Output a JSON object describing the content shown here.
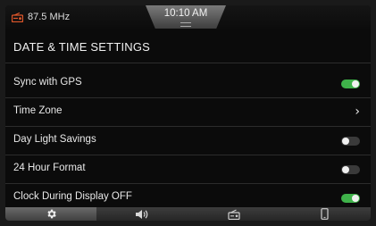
{
  "status_bar": {
    "radio_icon": "radio-icon",
    "frequency": "87.5 MHz",
    "time": "10:10 AM"
  },
  "page": {
    "title": "DATE & TIME SETTINGS"
  },
  "settings": [
    {
      "label": "Sync with GPS",
      "control": "toggle",
      "state": "on"
    },
    {
      "label": "Time Zone",
      "control": "chevron"
    },
    {
      "label": "Day Light Savings",
      "control": "toggle",
      "state": "off"
    },
    {
      "label": "24 Hour Format",
      "control": "toggle",
      "state": "off"
    },
    {
      "label": "Clock During Display OFF",
      "control": "toggle",
      "state": "on"
    }
  ],
  "chevron_glyph": "›",
  "bottom_nav": [
    {
      "icon": "gear-icon",
      "active": true
    },
    {
      "icon": "speaker-icon",
      "active": false
    },
    {
      "icon": "radio-icon",
      "active": false
    },
    {
      "icon": "phone-icon",
      "active": false
    }
  ],
  "colors": {
    "accent_on": "#3fb24a",
    "radio_icon": "#e0572b"
  }
}
